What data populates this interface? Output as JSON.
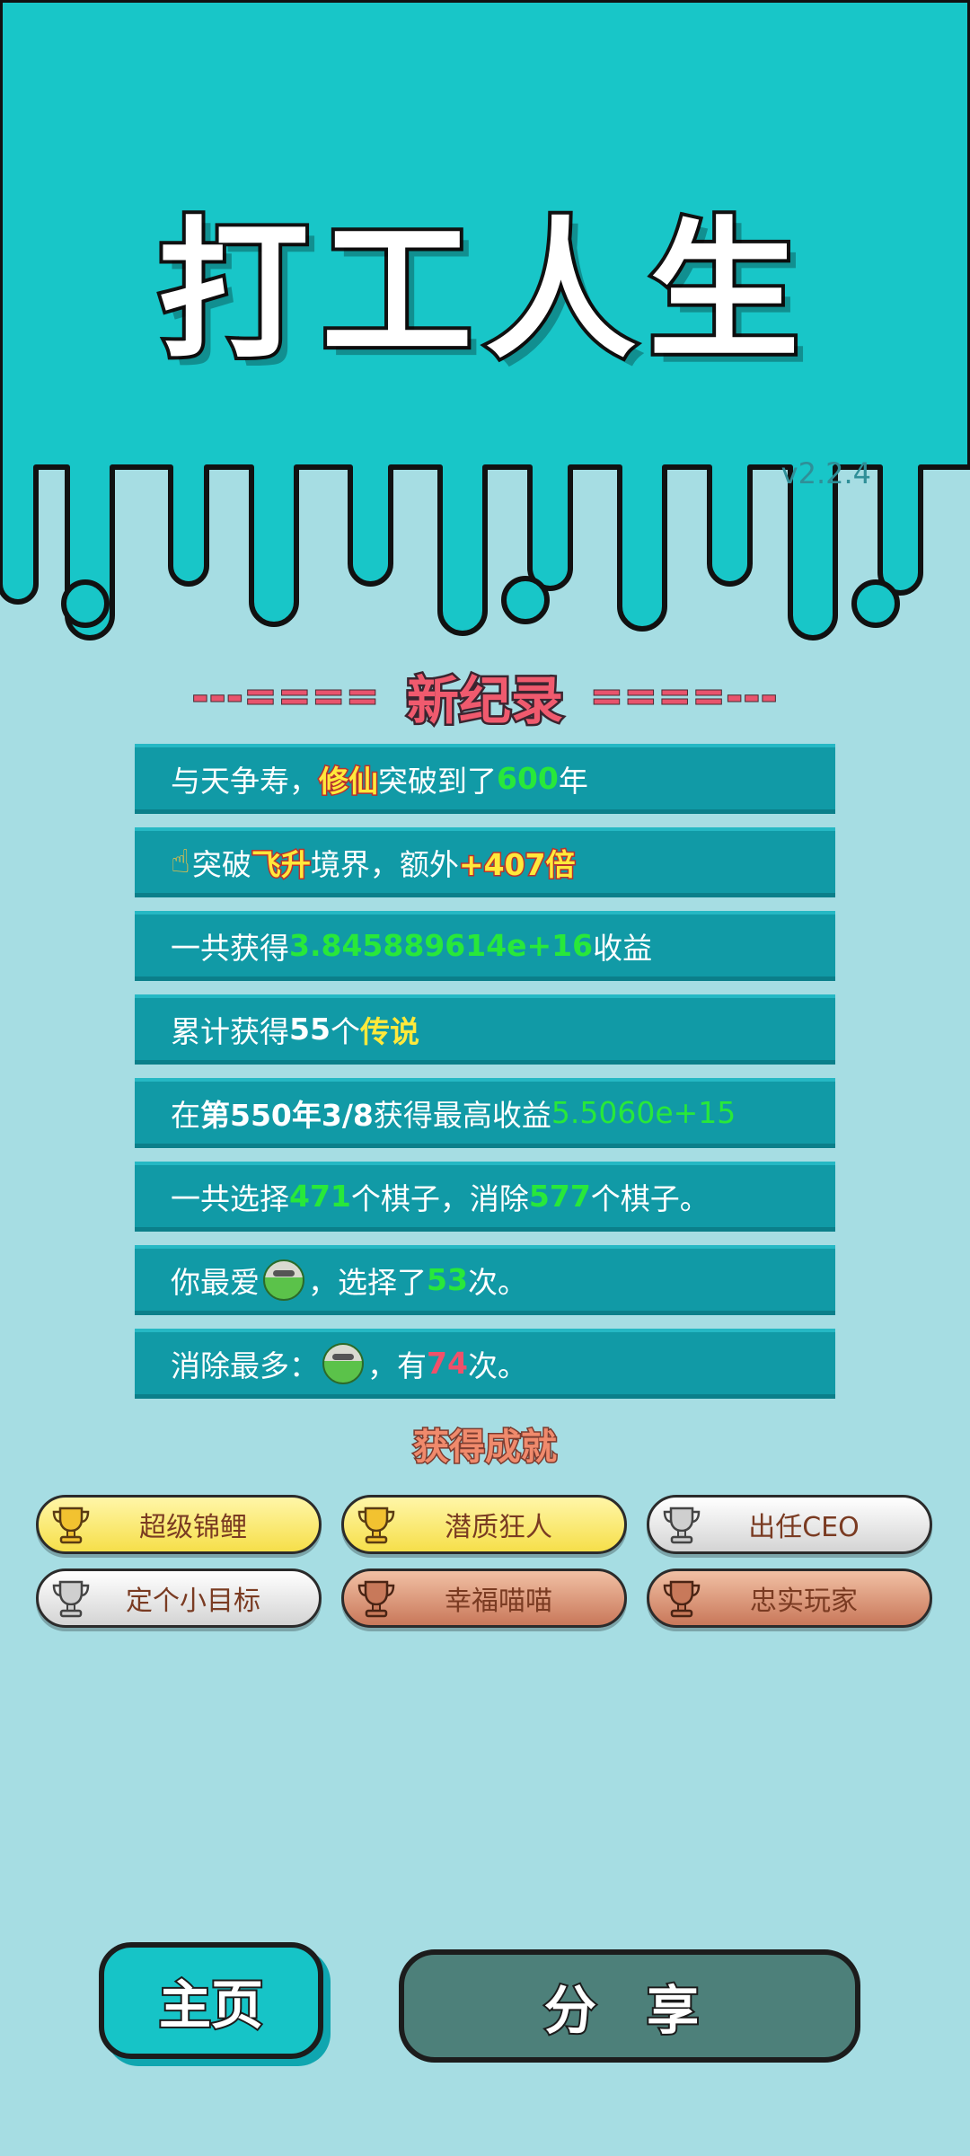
{
  "app": {
    "title": "打工人生",
    "version": "v2.2.4"
  },
  "colors": {
    "top_band": "#18c6c8",
    "background": "#a6dde3",
    "row": "#119aa6",
    "highlight_green": "#28e83a",
    "highlight_yellow": "#ffe93b",
    "highlight_red": "#f0506a"
  },
  "record": {
    "left_deco": "---====",
    "title": "新纪录",
    "right_deco": "====---"
  },
  "records": [
    {
      "p1": "与天争寿，",
      "h1": "修仙",
      "p2": "突破到了",
      "h2": "600",
      "p3": "年"
    },
    {
      "icon": "pointing-hand-icon",
      "p1": "突破",
      "h1": "飞升",
      "p2": "境界，额外",
      "h2": "+407倍"
    },
    {
      "p1": "一共获得",
      "h1": "3.845889614e+16",
      "p2": "收益"
    },
    {
      "p1": "累计获得",
      "h1": "55",
      "p2": "个",
      "h2": "传说"
    },
    {
      "p1": "在 ",
      "h1": "第550年3/8",
      "p2": " 获得最高收益",
      "h2": "5.5060e+15"
    },
    {
      "p1": "一共选择",
      "h1": "471",
      "p2": "个棋子，消除",
      "h2": "577",
      "p3": "个棋子。"
    },
    {
      "p1": "你最爱",
      "icon": "chess-piece-icon",
      "p2": "，选择了",
      "h1": "53",
      "p3": "次。"
    },
    {
      "p1": "消除最多：",
      "icon": "chess-piece-icon",
      "p2": "，有",
      "h1": "74",
      "p3": "次。"
    }
  ],
  "achievements": {
    "title": "获得成就",
    "items": [
      {
        "label": "超级锦鲤",
        "tier": "gold"
      },
      {
        "label": "潜质狂人",
        "tier": "gold"
      },
      {
        "label": "出任CEO",
        "tier": "silver"
      },
      {
        "label": "定个小目标",
        "tier": "silver"
      },
      {
        "label": "幸福喵喵",
        "tier": "bronze"
      },
      {
        "label": "忠实玩家",
        "tier": "bronze"
      }
    ]
  },
  "buttons": {
    "home": "主页",
    "share": "分 享"
  }
}
